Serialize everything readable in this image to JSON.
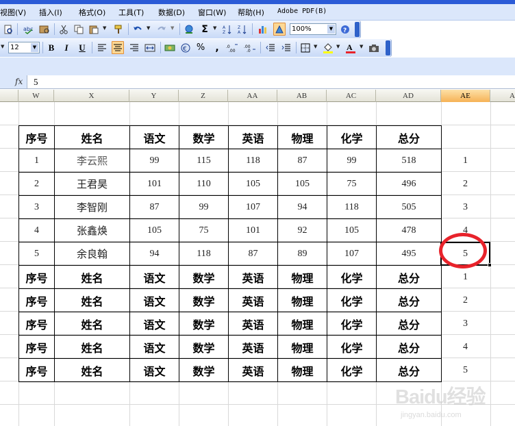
{
  "menubar": {
    "items": [
      "视图(V)",
      "插入(I)",
      "格式(O)",
      "工具(T)",
      "数据(D)",
      "窗口(W)",
      "帮助(H)",
      "Adobe PDF(B)"
    ]
  },
  "toolbar_standard": {
    "zoom": "100%"
  },
  "toolbar_format": {
    "font_size": "12",
    "bold": "B",
    "italic": "I",
    "underline": "U",
    "percent": "%",
    "comma": ","
  },
  "formula_bar": {
    "fx_label": "fx",
    "value": "5"
  },
  "columns": [
    {
      "label": "W"
    },
    {
      "label": "X"
    },
    {
      "label": "Y"
    },
    {
      "label": "Z"
    },
    {
      "label": "AA"
    },
    {
      "label": "AB"
    },
    {
      "label": "AC"
    },
    {
      "label": "AD"
    },
    {
      "label": "AE"
    },
    {
      "label": "A"
    }
  ],
  "table": {
    "header": [
      "序号",
      "姓名",
      "语文",
      "数学",
      "英语",
      "物理",
      "化学",
      "总分"
    ],
    "rows": [
      [
        "1",
        "李云熙",
        "99",
        "115",
        "118",
        "87",
        "99",
        "518"
      ],
      [
        "2",
        "王君昊",
        "101",
        "110",
        "105",
        "105",
        "75",
        "496"
      ],
      [
        "3",
        "李智刚",
        "87",
        "99",
        "107",
        "94",
        "118",
        "505"
      ],
      [
        "4",
        "张鑫焕",
        "105",
        "75",
        "101",
        "92",
        "105",
        "478"
      ],
      [
        "5",
        "余良翰",
        "94",
        "118",
        "87",
        "89",
        "107",
        "495"
      ]
    ],
    "repeated_header_rows": 5
  },
  "ae_values": [
    "1",
    "2",
    "3",
    "4",
    "5",
    "1",
    "2",
    "3",
    "4",
    "5"
  ],
  "selected_cell_value": "5",
  "watermark": {
    "brand": "Baidu经验",
    "url": "jingyan.baidu.com"
  },
  "colors": {
    "annotation_circle": "#e8232b",
    "selected_column_header": "#f6b256",
    "toolbar_blue": "#c8daf7"
  }
}
